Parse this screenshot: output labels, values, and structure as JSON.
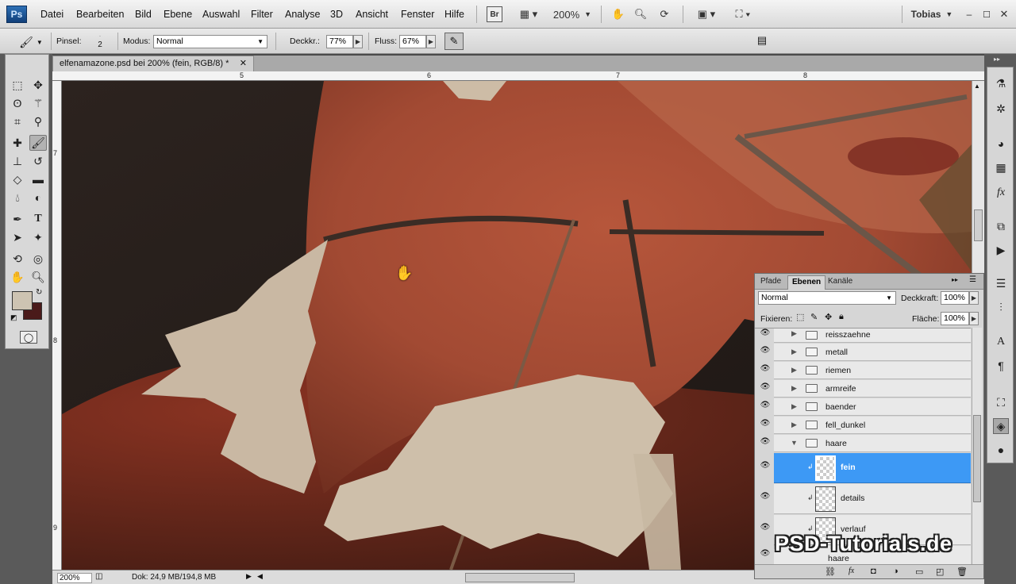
{
  "menubar": {
    "logo": "Ps",
    "items": [
      "Datei",
      "Bearbeiten",
      "Bild",
      "Ebene",
      "Auswahl",
      "Filter",
      "Analyse",
      "3D",
      "Ansicht",
      "Fenster",
      "Hilfe"
    ],
    "bridge": "Br",
    "zoom": "200%",
    "user": "Tobias"
  },
  "options": {
    "pinsel_label": "Pinsel:",
    "pinsel_size": "2",
    "modus_label": "Modus:",
    "modus_value": "Normal",
    "deckkraft_label": "Deckkr.:",
    "deckkraft_value": "77%",
    "fluss_label": "Fluss:",
    "fluss_value": "67%"
  },
  "document": {
    "tab_title": "elfenamazone.psd bei 200% (fein, RGB/8) *",
    "ruler_top": [
      "5",
      "6",
      "7",
      "8"
    ],
    "ruler_left": [
      "7",
      "8",
      "9"
    ]
  },
  "status": {
    "zoom": "200%",
    "doc": "Dok: 24,9 MB/194,8 MB"
  },
  "layers_panel": {
    "tabs": [
      "Pfade",
      "Ebenen",
      "Kanäle"
    ],
    "blend_mode": "Normal",
    "deckkraft_label": "Deckkraft:",
    "deckkraft_value": "100%",
    "fixieren_label": "Fixieren:",
    "flaeche_label": "Fläche:",
    "flaeche_value": "100%",
    "groups": [
      "reisszaehne",
      "metall",
      "riemen",
      "armreife",
      "baender",
      "fell_dunkel",
      "haare"
    ],
    "layers": [
      "fein",
      "details",
      "verlauf"
    ],
    "last_group": "haare"
  },
  "watermark": "PSD-Tutorials.de",
  "colors": {
    "foreground": "#cdc3b2",
    "background": "#4a1a1a",
    "selection": "#3d99f5"
  }
}
